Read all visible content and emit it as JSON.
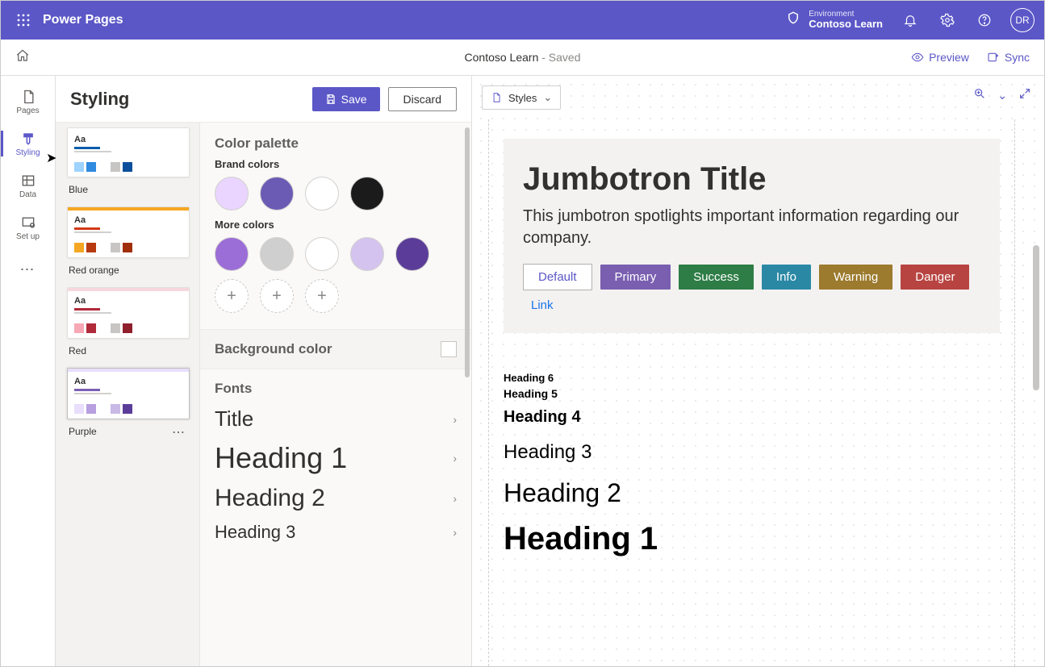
{
  "header": {
    "app_title": "Power Pages",
    "env_label": "Environment",
    "env_name": "Contoso Learn",
    "avatar_initials": "DR"
  },
  "subheader": {
    "doc_name": "Contoso Learn",
    "doc_status": " - Saved",
    "preview": "Preview",
    "sync": "Sync"
  },
  "rail": {
    "pages": "Pages",
    "styling": "Styling",
    "data": "Data",
    "setup": "Set up"
  },
  "styling_panel": {
    "title": "Styling",
    "save": "Save",
    "discard": "Discard"
  },
  "themes": [
    {
      "name": "Blue",
      "topbar": "#ffffff",
      "accent": "#0b5cab",
      "swatches": [
        "#9ed2ff",
        "#2f8ae0",
        "#ffffff",
        "#c8c6c4",
        "#0b4f9c"
      ]
    },
    {
      "name": "Red orange",
      "topbar": "#f5a623",
      "accent": "#d13a16",
      "swatches": [
        "#f5a623",
        "#b6390f",
        "#ffffff",
        "#c8c6c4",
        "#a12f0c"
      ]
    },
    {
      "name": "Red",
      "topbar": "#f7d7dd",
      "accent": "#b02a3a",
      "swatches": [
        "#f7a8b4",
        "#b02a3a",
        "#ffffff",
        "#c8c6c4",
        "#8f1f2d"
      ]
    },
    {
      "name": "Purple",
      "topbar": "#e9defc",
      "accent": "#7b5fb3",
      "swatches": [
        "#e9defc",
        "#b79fe0",
        "#ffffff",
        "#c8b9e6",
        "#5b3d99"
      ]
    }
  ],
  "palette": {
    "title": "Color palette",
    "brand_label": "Brand colors",
    "brand_colors": [
      "#e9d5ff",
      "#6b5bb5",
      "#ffffff",
      "#1b1b1b"
    ],
    "more_label": "More colors",
    "more_colors": [
      "#9b6dd7",
      "#cfcfcf",
      "#ffffff",
      "#d4c3ee",
      "#5b3d99"
    ]
  },
  "bgcolor_label": "Background color",
  "fonts": {
    "title": "Fonts",
    "items": [
      "Title",
      "Heading 1",
      "Heading 2",
      "Heading 3"
    ]
  },
  "preview": {
    "dropdown": "Styles",
    "jumbo_title": "Jumbotron Title",
    "jumbo_text": "This jumbotron spotlights important information regarding our company.",
    "buttons": {
      "default": "Default",
      "primary": "Primary",
      "success": "Success",
      "info": "Info",
      "warning": "Warning",
      "danger": "Danger",
      "link": "Link"
    },
    "button_colors": {
      "primary": "#7a5fb0",
      "success": "#2e7d46",
      "info": "#2b88a5",
      "warning": "#9c7a2e",
      "danger": "#b84441"
    },
    "headings": {
      "h6": "Heading 6",
      "h5": "Heading 5",
      "h4": "Heading 4",
      "h3": "Heading 3",
      "h2": "Heading 2",
      "h1": "Heading 1"
    }
  }
}
